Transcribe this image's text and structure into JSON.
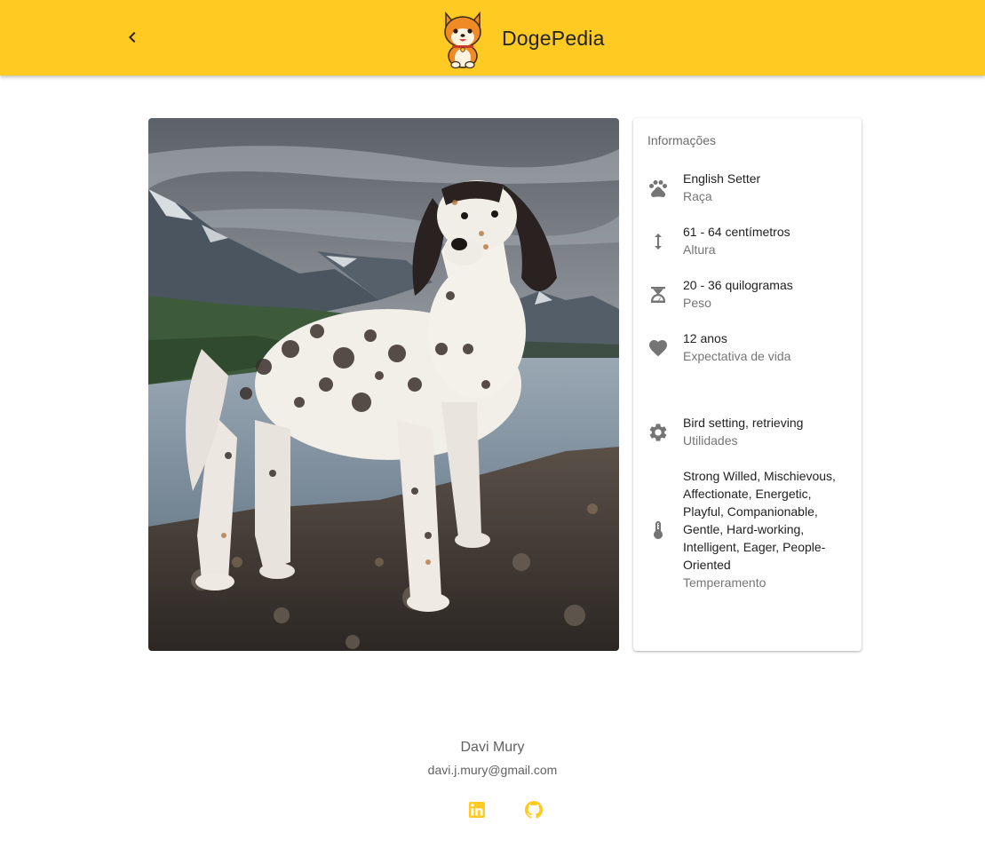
{
  "app": {
    "title": "DogePedia",
    "accent_color": "#ffca22",
    "logo_icon": "shiba-dog-logo",
    "back_icon": "chevron-left-icon"
  },
  "breed_image": {
    "alt": "English Setter"
  },
  "info_card": {
    "subheader": "Informações",
    "items": [
      {
        "icon": "paw-icon",
        "primary": "English Setter",
        "secondary": "Raça"
      },
      {
        "icon": "height-icon",
        "primary": "61 - 64 centímetros",
        "secondary": "Altura"
      },
      {
        "icon": "scale-icon",
        "primary": "20 - 36 quilogramas",
        "secondary": "Peso"
      },
      {
        "icon": "heart-icon",
        "primary": "12 anos",
        "secondary": "Expectativa de vida"
      },
      {
        "icon": "gear-icon",
        "primary": "Bird setting, retrieving",
        "secondary": "Utilidades"
      },
      {
        "icon": "thermometer-icon",
        "primary": "Strong Willed, Mischievous, Affectionate, Energetic, Playful, Companionable, Gentle, Hard-working, Intelligent, Eager, People-Oriented",
        "secondary": "Temperamento"
      }
    ]
  },
  "footer": {
    "name": "Davi Mury",
    "email": "davi.j.mury@gmail.com",
    "social": [
      {
        "icon": "linkedin-icon"
      },
      {
        "icon": "github-icon"
      }
    ],
    "social_color": "#ffca22"
  }
}
